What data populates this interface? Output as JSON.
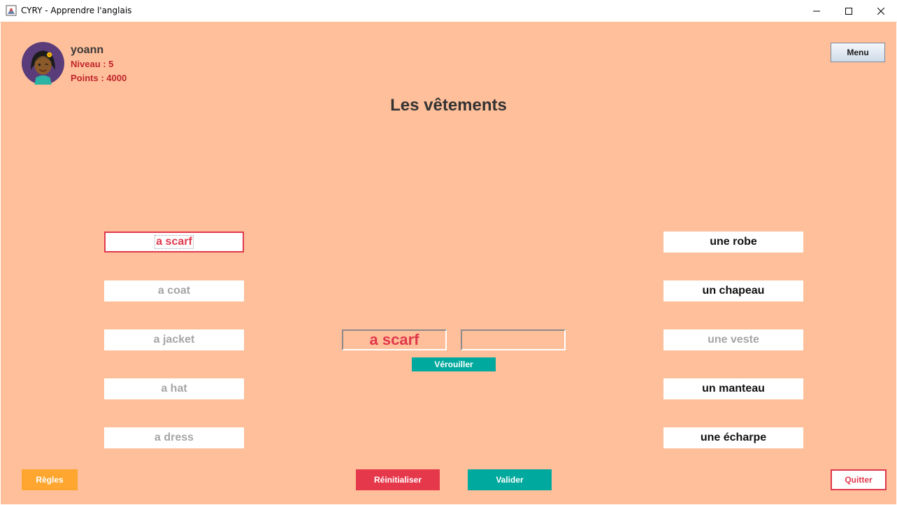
{
  "window": {
    "title": "CYRY - Apprendre l'anglais"
  },
  "user": {
    "name": "yoann",
    "level": "Niveau : 5",
    "points": "Points : 4000"
  },
  "menu_label": "Menu",
  "page_title": "Les vêtements",
  "english_words": [
    {
      "label": "a scarf",
      "state": "selected"
    },
    {
      "label": "a coat",
      "state": "dimmed"
    },
    {
      "label": "a jacket",
      "state": "dimmed"
    },
    {
      "label": "a hat",
      "state": "dimmed"
    },
    {
      "label": "a dress",
      "state": "dimmed"
    }
  ],
  "french_words": [
    {
      "label": "une robe",
      "state": "available"
    },
    {
      "label": "un chapeau",
      "state": "available"
    },
    {
      "label": "une veste",
      "state": "dimmed"
    },
    {
      "label": "un manteau",
      "state": "available"
    },
    {
      "label": "une écharpe",
      "state": "available"
    }
  ],
  "pair": {
    "english": "a scarf",
    "french": ""
  },
  "lock_label": "Vérouiller",
  "buttons": {
    "rules": "Règles",
    "reset": "Réinitialiser",
    "validate": "Valider",
    "quit": "Quitter"
  },
  "colors": {
    "background": "#ffbf9a",
    "accent_red": "#e0384c",
    "teal": "#00a99d",
    "orange": "#ffa630"
  }
}
